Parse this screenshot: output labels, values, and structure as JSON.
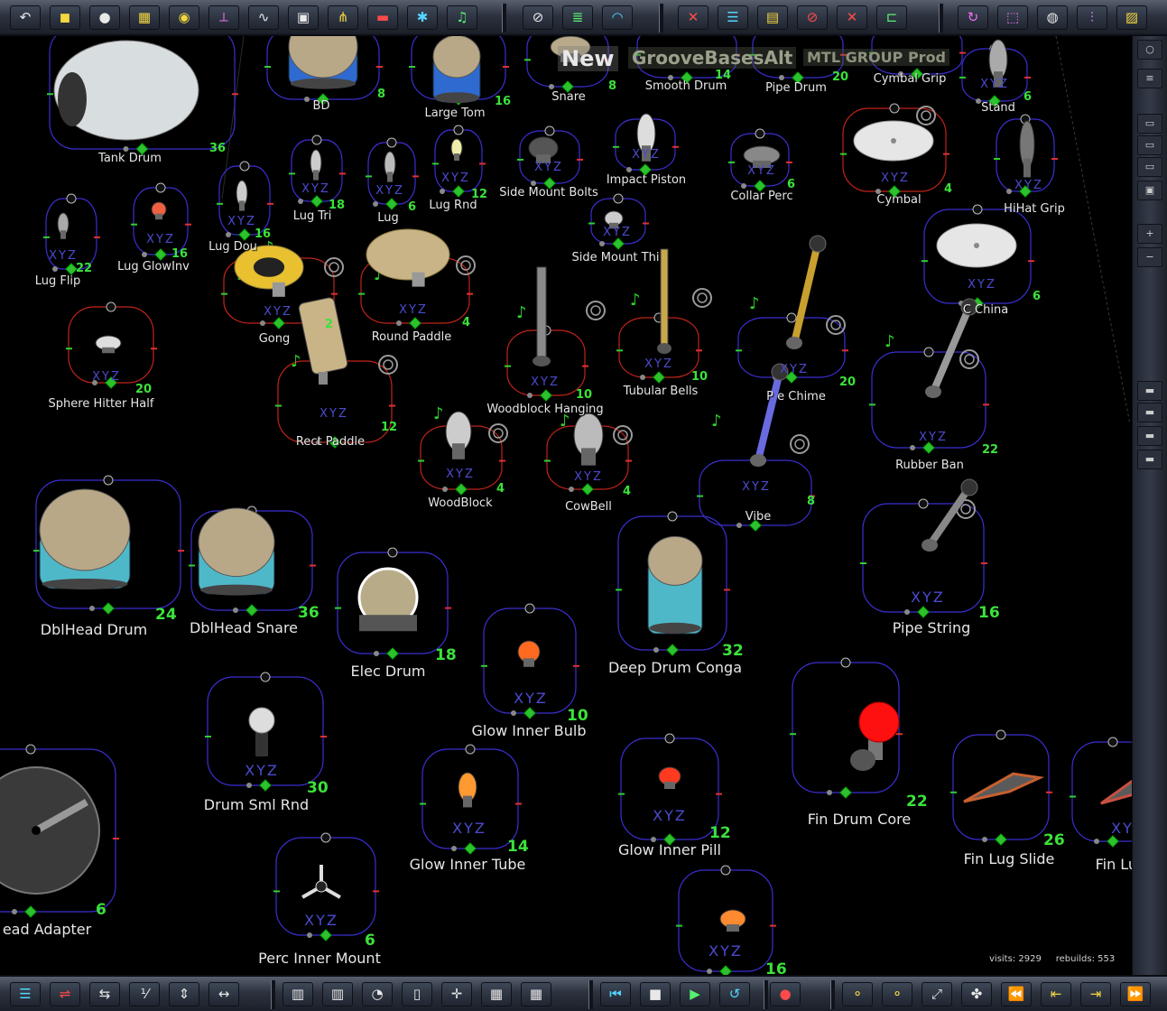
{
  "scene": {
    "title": "New",
    "group": "GrooveBasesAlt",
    "product": "MTL GROUP Prod",
    "xyz_label": "XYZ"
  },
  "stats": {
    "visits_label": "visits:",
    "visits": "2929",
    "rebuilds_label": "rebuilds:",
    "rebuilds": "553"
  },
  "colors": {
    "frame_blue": "#3a2fd0",
    "frame_red": "#c0231a",
    "count_green": "#3be23b",
    "toolbar": "#2c323e"
  },
  "top_toolbar": [
    {
      "name": "undo-icon",
      "glyph": "↶"
    },
    {
      "name": "cube-icon",
      "glyph": "◼"
    },
    {
      "name": "light-icon",
      "glyph": "●"
    },
    {
      "name": "grid-icon",
      "glyph": "▦"
    },
    {
      "name": "spotlight-icon",
      "glyph": "◉"
    },
    {
      "name": "axes-icon",
      "glyph": "⟂"
    },
    {
      "name": "graph-icon",
      "glyph": "∿"
    },
    {
      "name": "camera-icon",
      "glyph": "▣"
    },
    {
      "name": "fountain-icon",
      "glyph": "⋔"
    },
    {
      "name": "film-icon",
      "glyph": "▬"
    },
    {
      "name": "transform-icon",
      "glyph": "✱"
    },
    {
      "name": "music-icon",
      "glyph": "♫"
    },
    {
      "name": "link-icon",
      "glyph": "⊘"
    },
    {
      "name": "stack-icon",
      "glyph": "≣"
    },
    {
      "name": "swirl-icon",
      "glyph": "◠"
    },
    {
      "name": "delete-icon",
      "glyph": "✕"
    },
    {
      "name": "list-icon",
      "glyph": "☰"
    },
    {
      "name": "layers-icon",
      "glyph": "▤"
    },
    {
      "name": "no-entry-icon",
      "glyph": "⊘"
    },
    {
      "name": "close-icon",
      "glyph": "✕"
    },
    {
      "name": "tree-icon",
      "glyph": "⊏"
    },
    {
      "name": "refresh-icon",
      "glyph": "↻"
    },
    {
      "name": "frame-icon",
      "glyph": "⬚"
    },
    {
      "name": "globe-icon",
      "glyph": "◍"
    },
    {
      "name": "sliders-icon",
      "glyph": "⫶"
    },
    {
      "name": "palette-icon",
      "glyph": "▨"
    }
  ],
  "bottom_toolbar": [
    {
      "name": "align-icon",
      "glyph": "☰"
    },
    {
      "name": "route-icon",
      "glyph": "⇌"
    },
    {
      "name": "move-icon",
      "glyph": "⇆"
    },
    {
      "name": "numbers-icon",
      "glyph": "⅟"
    },
    {
      "name": "distribute-icon",
      "glyph": "⇕"
    },
    {
      "name": "span-icon",
      "glyph": "↔"
    },
    {
      "name": "columns-icon",
      "glyph": "▥"
    },
    {
      "name": "bars-icon",
      "glyph": "▥"
    },
    {
      "name": "dial-icon",
      "glyph": "◔"
    },
    {
      "name": "book-icon",
      "glyph": "▯"
    },
    {
      "name": "split-icon",
      "glyph": "✛"
    },
    {
      "name": "grid-a-icon",
      "glyph": "▦"
    },
    {
      "name": "grid-b-icon",
      "glyph": "▦"
    },
    {
      "name": "first-icon",
      "glyph": "⏮"
    },
    {
      "name": "stop-icon",
      "glyph": "■"
    },
    {
      "name": "play-icon",
      "glyph": "▶"
    },
    {
      "name": "loop-icon",
      "glyph": "↺"
    },
    {
      "name": "record-icon",
      "glyph": "●"
    },
    {
      "name": "nodes-a-icon",
      "glyph": "⚬"
    },
    {
      "name": "nodes-b-icon",
      "glyph": "⚬"
    },
    {
      "name": "link-diag-icon",
      "glyph": "⤢"
    },
    {
      "name": "network-icon",
      "glyph": "✤"
    },
    {
      "name": "rewind-icon",
      "glyph": "⏪"
    },
    {
      "name": "step-back-icon",
      "glyph": "⇤"
    },
    {
      "name": "step-fwd-icon",
      "glyph": "⇥"
    },
    {
      "name": "fast-forward-icon",
      "glyph": "⏩"
    }
  ],
  "right_panel": [
    {
      "name": "record-mode-icon",
      "glyph": "○"
    },
    {
      "name": "menu-icon",
      "glyph": "≡"
    },
    {
      "name": "window-icon",
      "glyph": "▭"
    },
    {
      "name": "panel-icon",
      "glyph": "▭"
    },
    {
      "name": "panel-b-icon",
      "glyph": "▭"
    },
    {
      "name": "save-icon",
      "glyph": "▣"
    },
    {
      "name": "zoom-in-icon",
      "glyph": "+"
    },
    {
      "name": "zoom-out-icon",
      "glyph": "−"
    },
    {
      "name": "view-a-icon",
      "glyph": "▬"
    },
    {
      "name": "view-b-icon",
      "glyph": "▬"
    },
    {
      "name": "view-c-icon",
      "glyph": "▬"
    },
    {
      "name": "view-d-icon",
      "glyph": "▬"
    }
  ],
  "nodes": [
    {
      "id": "tank-drum",
      "label": "Tank Drum",
      "count": "36"
    },
    {
      "id": "bd",
      "label": "BD",
      "count": "8"
    },
    {
      "id": "large-tom",
      "label": "Large Tom",
      "count": "16"
    },
    {
      "id": "snare",
      "label": "Snare",
      "count": "8"
    },
    {
      "id": "smooth-drum",
      "label": "Smooth Drum",
      "count": "14"
    },
    {
      "id": "pipe-drum",
      "label": "Pipe Drum",
      "count": "20"
    },
    {
      "id": "cymbal-grip",
      "label": "Cymbal Grip",
      "count": ""
    },
    {
      "id": "stand",
      "label": "Stand",
      "count": "6"
    },
    {
      "id": "lug-tri",
      "label": "Lug Tri",
      "count": "18"
    },
    {
      "id": "lug",
      "label": "Lug",
      "count": "6"
    },
    {
      "id": "lug-rnd",
      "label": "Lug Rnd",
      "count": "12"
    },
    {
      "id": "side-mount-bolts",
      "label": "Side Mount Bolts",
      "count": ""
    },
    {
      "id": "impact-piston",
      "label": "Impact Piston",
      "count": ""
    },
    {
      "id": "collar-perc",
      "label": "Collar Perc",
      "count": "6"
    },
    {
      "id": "cymbal",
      "label": "Cymbal",
      "count": "4"
    },
    {
      "id": "hihat-grip",
      "label": "HiHat Grip",
      "count": ""
    },
    {
      "id": "lug-flip",
      "label": "Lug Flip",
      "count": "22"
    },
    {
      "id": "lug-glowinv",
      "label": "Lug GlowInv",
      "count": "16"
    },
    {
      "id": "lug-dou",
      "label": "Lug Dou",
      "count": "16"
    },
    {
      "id": "side-mount-thi",
      "label": "Side Mount Thi",
      "count": ""
    },
    {
      "id": "gong",
      "label": "Gong",
      "count": "2"
    },
    {
      "id": "round-paddle",
      "label": "Round Paddle",
      "count": "4"
    },
    {
      "id": "china",
      "label": "C   China",
      "count": "6"
    },
    {
      "id": "sphere-hitter-half",
      "label": "Sphere Hitter Half",
      "count": "20"
    },
    {
      "id": "woodblock-hanging",
      "label": "Woodblock Hanging",
      "count": "10"
    },
    {
      "id": "tubular-bells",
      "label": "Tubular Bells",
      "count": "10"
    },
    {
      "id": "pipe-chime",
      "label": "P   e Chime",
      "count": "20"
    },
    {
      "id": "rubber-band",
      "label": "Rubber Ban",
      "count": "22"
    },
    {
      "id": "rect-paddle",
      "label": "Rect Paddle",
      "count": "12"
    },
    {
      "id": "woodblock",
      "label": "WoodBlock",
      "count": "4"
    },
    {
      "id": "cowbell",
      "label": "CowBell",
      "count": "4"
    },
    {
      "id": "vibe",
      "label": "Vibe",
      "count": "8"
    },
    {
      "id": "dblhead-drum",
      "label": "DblHead Drum",
      "count": "24"
    },
    {
      "id": "dblhead-snare",
      "label": "DblHead Snare",
      "count": "36"
    },
    {
      "id": "elec-drum",
      "label": "Elec Drum",
      "count": "18"
    },
    {
      "id": "deep-drum-conga",
      "label": "Deep Drum Conga",
      "count": "32"
    },
    {
      "id": "pipe-string",
      "label": "Pipe String",
      "count": "16"
    },
    {
      "id": "glow-inner-bulb",
      "label": "Glow Inner Bulb",
      "count": "10"
    },
    {
      "id": "drum-sml-rnd",
      "label": "Drum Sml Rnd",
      "count": "30"
    },
    {
      "id": "fin-drum-core",
      "label": "Fin Drum Core",
      "count": "22"
    },
    {
      "id": "glow-inner-tube",
      "label": "Glow Inner Tube",
      "count": "14"
    },
    {
      "id": "glow-inner-pill",
      "label": "Glow Inner Pill",
      "count": "12"
    },
    {
      "id": "fin-lug-slide",
      "label": "Fin Lug Slide",
      "count": "26"
    },
    {
      "id": "fin-lug-r",
      "label": "Fin Lug R",
      "count": ""
    },
    {
      "id": "head-adapter",
      "label": "ead Adapter",
      "count": "6"
    },
    {
      "id": "perc-inner-mount",
      "label": "Perc Inner Mount",
      "count": "6"
    },
    {
      "id": "bottom-node",
      "label": "",
      "count": "16"
    }
  ]
}
